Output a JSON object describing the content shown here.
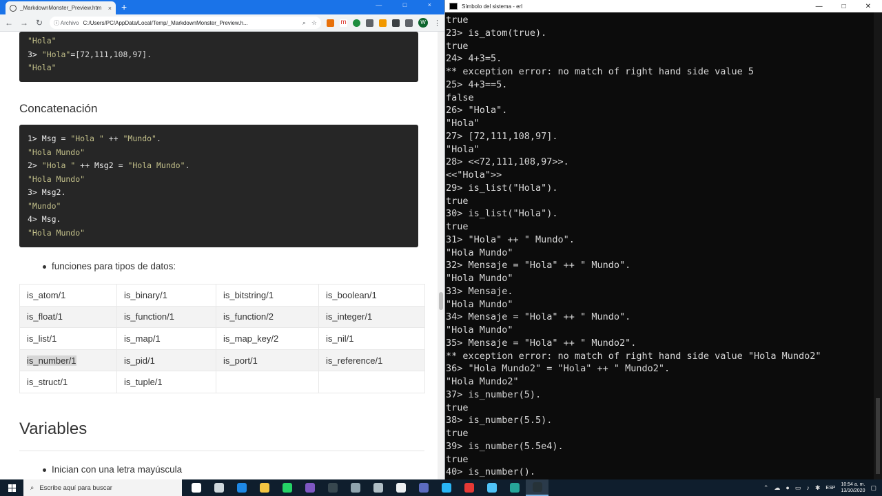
{
  "browser": {
    "tab_title": "_MarkdownMonster_Preview.htm",
    "tab_close": "×",
    "new_tab": "+",
    "back": "←",
    "forward": "→",
    "reload": "↻",
    "security_label": "ⓘ Archivo",
    "url": "C:/Users/PC/AppData/Local/Temp/_MarkdownMonster_Preview.h...",
    "profile_letter": "W"
  },
  "doc": {
    "code1_lines": [
      [
        {
          "t": "s",
          "v": "\"Hola\""
        }
      ],
      [
        {
          "t": "p",
          "v": "3> "
        },
        {
          "t": "s",
          "v": "\"Hola\""
        },
        {
          "t": "o",
          "v": "=[72,111,108,97]."
        }
      ],
      [
        {
          "t": "s",
          "v": "\"Hola\""
        }
      ]
    ],
    "concat_heading": "Concatenación",
    "code2_lines": [
      [
        {
          "t": "p",
          "v": "1> Msg "
        },
        {
          "t": "o",
          "v": "= "
        },
        {
          "t": "s",
          "v": "\"Hola \""
        },
        {
          "t": "o",
          "v": " ++ "
        },
        {
          "t": "s",
          "v": "\"Mundo\""
        },
        {
          "t": "o",
          "v": "."
        }
      ],
      [
        {
          "t": "s",
          "v": "\"Hola Mundo\""
        }
      ],
      [
        {
          "t": "p",
          "v": "2> "
        },
        {
          "t": "s",
          "v": "\"Hola \""
        },
        {
          "t": "o",
          "v": " ++ "
        },
        {
          "t": "p",
          "v": "Msg2 "
        },
        {
          "t": "o",
          "v": "= "
        },
        {
          "t": "s",
          "v": "\"Hola Mundo\""
        },
        {
          "t": "o",
          "v": "."
        }
      ],
      [
        {
          "t": "s",
          "v": "\"Hola Mundo\""
        }
      ],
      [
        {
          "t": "p",
          "v": "3> Msg2."
        }
      ],
      [
        {
          "t": "s",
          "v": "\"Mundo\""
        }
      ],
      [
        {
          "t": "p",
          "v": "4> Msg."
        }
      ],
      [
        {
          "t": "s",
          "v": "\"Hola Mundo\""
        }
      ]
    ],
    "bullet_functions": "funciones para tipos de datos:",
    "functions_table": [
      [
        "is_atom/1",
        "is_binary/1",
        "is_bitstring/1",
        "is_boolean/1"
      ],
      [
        "is_float/1",
        "is_function/1",
        "is_function/2",
        "is_integer/1"
      ],
      [
        "is_list/1",
        "is_map/1",
        "is_map_key/2",
        "is_nil/1"
      ],
      [
        "is_number/1",
        "is_pid/1",
        "is_port/1",
        "is_reference/1"
      ],
      [
        "is_struct/1",
        "is_tuple/1",
        "",
        ""
      ]
    ],
    "highlighted_cell": "is_number/1",
    "variables_heading": "Variables",
    "bullet_variables": "Inician con una letra mayúscula"
  },
  "terminal": {
    "title": "Símbolo del sistema - erl",
    "lines": [
      "true",
      "23> is_atom(true).",
      "true",
      "24> 4+3=5.",
      "** exception error: no match of right hand side value 5",
      "25> 4+3==5.",
      "false",
      "26> \"Hola\".",
      "\"Hola\"",
      "27> [72,111,108,97].",
      "\"Hola\"",
      "28> <<72,111,108,97>>.",
      "<<\"Hola\">>",
      "29> is_list(\"Hola\").",
      "true",
      "30> is_list(\"Hola\").",
      "true",
      "31> \"Hola\" ++ \" Mundo\".",
      "\"Hola Mundo\"",
      "32> Mensaje = \"Hola\" ++ \" Mundo\".",
      "\"Hola Mundo\"",
      "33> Mensaje.",
      "\"Hola Mundo\"",
      "34> Mensaje = \"Hola\" ++ \" Mundo\".",
      "\"Hola Mundo\"",
      "35> Mensaje = \"Hola\" ++ \" Mundo2\".",
      "** exception error: no match of right hand side value \"Hola Mundo2\"",
      "36> \"Hola Mundo2\" = \"Hola\" ++ \" Mundo2\".",
      "\"Hola Mundo2\"",
      "37> is_number(5).",
      "true",
      "38> is_number(5.5).",
      "true",
      "39> is_number(5.5e4).",
      "true",
      "40> is_number()."
    ]
  },
  "taskbar": {
    "search_placeholder": "Escribe aquí para buscar",
    "language": "ESP",
    "time": "10:54 a. m.",
    "date": "13/10/2020",
    "app_icons": [
      {
        "name": "task-view-icon",
        "color": "#ffffff"
      },
      {
        "name": "timeline-icon",
        "color": "#cfd8dc"
      },
      {
        "name": "edge-icon",
        "color": "#1e88e5"
      },
      {
        "name": "file-explorer-icon",
        "color": "#f4c542"
      },
      {
        "name": "whatsapp-icon",
        "color": "#25d366"
      },
      {
        "name": "visual-studio-icon",
        "color": "#7e57c2"
      },
      {
        "name": "terminal-app-icon",
        "color": "#37474f"
      },
      {
        "name": "app-icon-a",
        "color": "#90a4ae"
      },
      {
        "name": "app-icon-b",
        "color": "#b0bec5"
      },
      {
        "name": "maps-icon",
        "color": "#eceff1"
      },
      {
        "name": "obs-icon",
        "color": "#5c6bc0"
      },
      {
        "name": "app-icon-c",
        "color": "#29b6f6"
      },
      {
        "name": "chrome-icon",
        "color": "#e53935"
      },
      {
        "name": "app-icon-d",
        "color": "#4fc3f7"
      },
      {
        "name": "edge-dev-icon",
        "color": "#26a69a"
      },
      {
        "name": "command-prompt-icon",
        "color": "#263238",
        "active": true
      }
    ]
  }
}
